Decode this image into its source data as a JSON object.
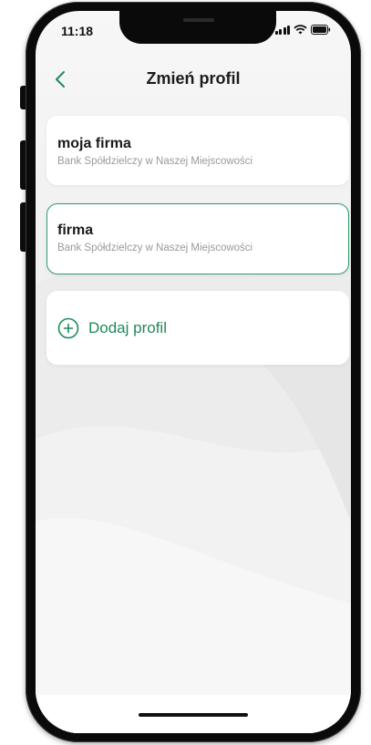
{
  "status_bar": {
    "time": "11:18",
    "icons": [
      "signal-icon",
      "wifi-icon",
      "battery-icon"
    ]
  },
  "header": {
    "title": "Zmień profil",
    "back_icon": "chevron-left-icon"
  },
  "profiles": [
    {
      "name": "moja firma",
      "bank": "Bank Spółdzielczy w Naszej Miejscowości",
      "selected": false
    },
    {
      "name": "firma",
      "bank": "Bank Spółdzielczy w Naszej Miejscowości",
      "selected": true
    }
  ],
  "add_profile": {
    "label": "Dodaj profil",
    "icon": "plus-circle-icon"
  },
  "colors": {
    "accent": "#1f8a5a",
    "selected_border": "#2f9a6a",
    "title": "#1b1b1b",
    "subtitle": "#9a9a9a"
  }
}
